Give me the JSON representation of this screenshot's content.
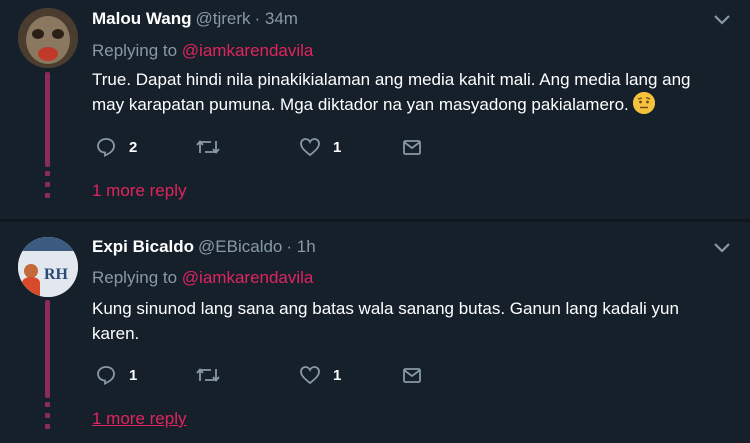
{
  "tweets": [
    {
      "name": "Malou Wang",
      "handle": "@tjrerk",
      "time": "· 34m",
      "replying_prefix": "Replying to",
      "replying_to": "@iamkarendavila",
      "text": "True. Dapat hindi nila pinakikialaman ang media kahit mali. Ang media lang ang may karapatan pumuna. Mga diktador na yan masyadong pakialamero.",
      "emoji": "face-with-raised-eyebrow",
      "reply_count": "2",
      "retweet_count": "",
      "like_count": "1",
      "more_replies": "1 more reply"
    },
    {
      "name": "Expi Bicaldo",
      "handle": "@EBicaldo",
      "time": "· 1h",
      "replying_prefix": "Replying to",
      "replying_to": "@iamkarendavila",
      "text": "Kung sinunod lang sana ang batas wala sanang butas. Ganun lang kadali yun karen.",
      "avatar_text": "RH",
      "reply_count": "1",
      "retweet_count": "",
      "like_count": "1",
      "more_replies": "1 more reply"
    }
  ],
  "colors": {
    "background": "#15202b",
    "accent": "#e0245e",
    "muted": "#8899a6",
    "thread": "#8b2a5e"
  }
}
